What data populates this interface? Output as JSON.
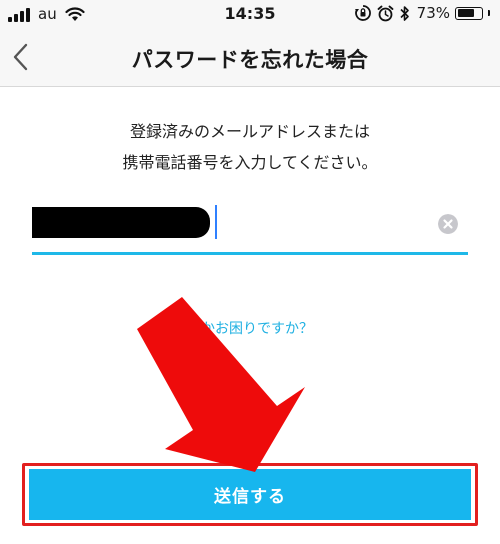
{
  "status_bar": {
    "carrier": "au",
    "time": "14:35",
    "battery_percent": "73%",
    "battery_level": 0.73,
    "icons": [
      "signal-icon",
      "wifi-icon",
      "screen-rotation-lock-icon",
      "alarm-icon",
      "bluetooth-icon",
      "battery-icon"
    ]
  },
  "nav": {
    "back_icon": "chevron-left-icon",
    "title": "パスワードを忘れた場合"
  },
  "instruction": {
    "line1": "登録済みのメールアドレスまたは",
    "line2": "携帯電話番号を入力してください。"
  },
  "input": {
    "value": "",
    "redacted": true,
    "clear_icon": "clear-icon"
  },
  "help_link": {
    "label": "何かお困りですか？"
  },
  "submit": {
    "label": "送信する"
  },
  "colors": {
    "accent": "#17b6ee",
    "link": "#1fb0e2",
    "annotation_red": "#e21f1f",
    "bar_background": "#f7f7f7"
  }
}
